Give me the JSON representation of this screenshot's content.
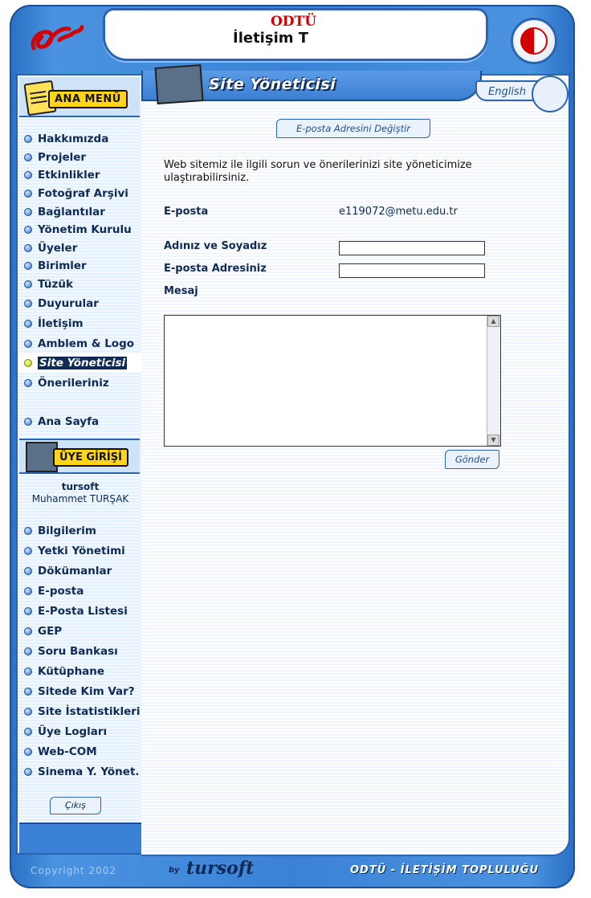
{
  "header": {
    "brand_top": "ODTÜ",
    "brand_bottom": "İletişim T"
  },
  "sidebar": {
    "menu_title": "ANA MENÜ",
    "items": [
      {
        "label": "Hakkımızda"
      },
      {
        "label": "Projeler"
      },
      {
        "label": "Etkinlikler"
      },
      {
        "label": "Fotoğraf Arşivi"
      },
      {
        "label": "Bağlantılar"
      },
      {
        "label": "Yönetim Kurulu"
      },
      {
        "label": "Üyeler"
      },
      {
        "label": "Birimler"
      },
      {
        "label": "Tüzük"
      },
      {
        "label": "Duyurular"
      },
      {
        "label": "İletişim"
      },
      {
        "label": "Amblem & Logo"
      },
      {
        "label": "Site Yöneticisi",
        "active": true
      },
      {
        "label": "Önerileriniz"
      }
    ],
    "home_label": "Ana Sayfa",
    "member_title": "ÜYE GİRİŞİ",
    "user": {
      "username": "tursoft",
      "full_name": "Muhammet TURŞAK"
    },
    "member_items": [
      {
        "label": "Bilgilerim"
      },
      {
        "label": "Yetki Yönetimi"
      },
      {
        "label": "Dökümanlar"
      },
      {
        "label": "E-posta"
      },
      {
        "label": "E-Posta Listesi"
      },
      {
        "label": "GEP"
      },
      {
        "label": "Soru Bankası"
      },
      {
        "label": "Kütüphane"
      },
      {
        "label": "Sitede Kim Var?"
      },
      {
        "label": "Site İstatistikleri"
      },
      {
        "label": "Üye Logları"
      },
      {
        "label": "Web-COM"
      },
      {
        "label": "Sinema Y. Yönet."
      }
    ],
    "logout_label": "Çıkış"
  },
  "main": {
    "title": "Site Yöneticisi",
    "language_label": "English",
    "change_email_button": "E-posta Adresini Değiştir",
    "intro_text": "Web sitemiz ile ilgili sorun ve önerilerinizi site yöneticimize ulaştırabilirsiniz.",
    "email_label": "E-posta",
    "email_value": "e119072@metu.edu.tr",
    "name_label": "Adınız ve Soyadız",
    "name_value": "",
    "your_email_label": "E-posta Adresiniz",
    "your_email_value": "",
    "message_label": "Mesaj",
    "message_value": "",
    "send_button": "Gönder"
  },
  "footer": {
    "copyright": "Copyright 2002",
    "by": "by",
    "author": "tursoft",
    "right_text": "ODTÜ - İLETİŞİM TOPLULUĞU"
  },
  "colors": {
    "frame_blue": "#3b82d6",
    "dark_navy": "#0f2a55",
    "accent_yellow": "#ffd51a",
    "brand_red": "#d40000"
  }
}
